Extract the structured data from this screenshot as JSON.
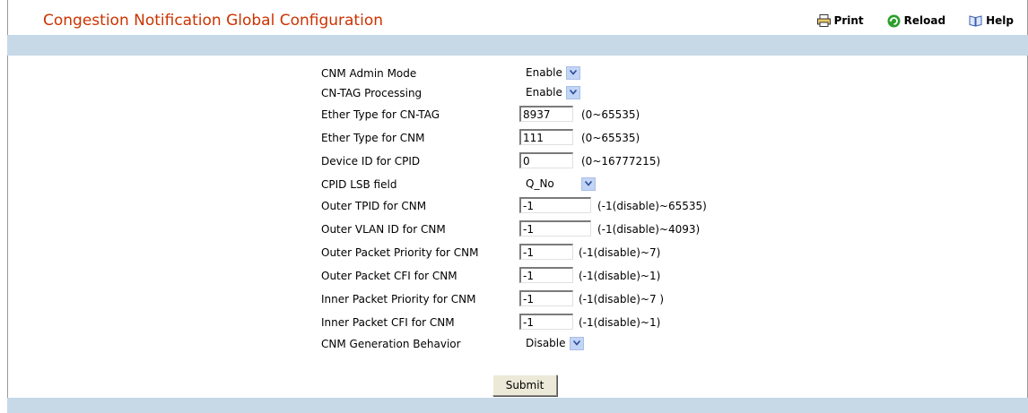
{
  "page": {
    "title": "Congestion Notification Global Configuration"
  },
  "toolbar": {
    "print_label": "Print",
    "reload_label": "Reload",
    "help_label": "Help"
  },
  "fields": [
    {
      "label": "CNM Admin Mode",
      "type": "select",
      "value": "Enable"
    },
    {
      "label": "CN-TAG Processing",
      "type": "select",
      "value": "Enable"
    },
    {
      "label": "Ether Type for CN-TAG",
      "type": "input",
      "value": "8937",
      "range": "(0~65535)"
    },
    {
      "label": "Ether Type for CNM",
      "type": "input",
      "value": "111",
      "range": "(0~65535)"
    },
    {
      "label": "Device ID for CPID",
      "type": "input",
      "value": "0",
      "range": "(0~16777215)"
    },
    {
      "label": "CPID LSB field",
      "type": "select",
      "value": "Q_No"
    },
    {
      "label": "Outer TPID for CNM",
      "type": "input",
      "value": "-1",
      "range": "(-1(disable)~65535)"
    },
    {
      "label": "Outer VLAN ID for CNM",
      "type": "input",
      "value": "-1",
      "range": "(-1(disable)~4093)"
    },
    {
      "label": "Outer Packet Priority for CNM",
      "type": "input",
      "value": "-1",
      "range": "(-1(disable)~7)"
    },
    {
      "label": "Outer Packet CFI for CNM",
      "type": "input",
      "value": "-1",
      "range": "(-1(disable)~1)"
    },
    {
      "label": "Inner Packet Priority for CNM",
      "type": "input",
      "value": "-1",
      "range": "(-1(disable)~7 )"
    },
    {
      "label": "Inner Packet CFI for CNM",
      "type": "input",
      "value": "-1",
      "range": "(-1(disable)~1)"
    },
    {
      "label": "CNM Generation Behavior",
      "type": "select",
      "value": "Disable"
    }
  ],
  "submit_label": "Submit",
  "colors": {
    "title": "#cc3300",
    "band": "#c7d8e6",
    "select_arrow": "#c3d5f5",
    "reload_icon": "#2e9e2e"
  }
}
